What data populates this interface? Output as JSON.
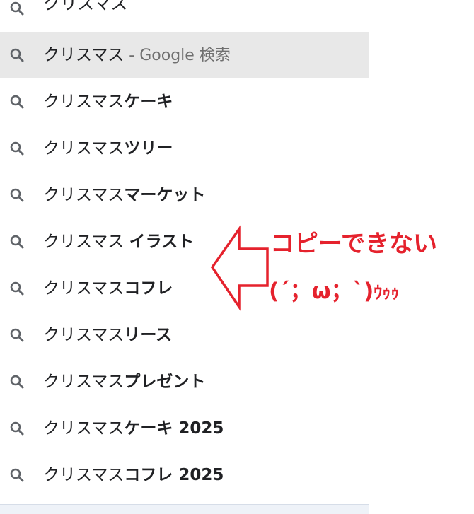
{
  "omnibox": {
    "input_text": "クリスマス"
  },
  "suggestions": [
    {
      "prefix": "クリスマス",
      "bold": "",
      "suffix": " - Google 検索",
      "selected": true
    },
    {
      "prefix": "クリスマス",
      "bold": "ケーキ",
      "suffix": "",
      "selected": false
    },
    {
      "prefix": "クリスマス",
      "bold": "ツリー",
      "suffix": "",
      "selected": false
    },
    {
      "prefix": "クリスマス",
      "bold": "マーケット",
      "suffix": "",
      "selected": false
    },
    {
      "prefix": "クリスマス ",
      "bold": "イラスト",
      "suffix": "",
      "selected": false
    },
    {
      "prefix": "クリスマス",
      "bold": "コフレ",
      "suffix": "",
      "selected": false
    },
    {
      "prefix": "クリスマス",
      "bold": "リース",
      "suffix": "",
      "selected": false
    },
    {
      "prefix": "クリスマス",
      "bold": "プレゼント",
      "suffix": "",
      "selected": false
    },
    {
      "prefix": "クリスマス",
      "bold": "ケーキ 2025",
      "suffix": "",
      "selected": false
    },
    {
      "prefix": "クリスマス",
      "bold": "コフレ 2025",
      "suffix": "",
      "selected": false
    }
  ],
  "annotation": {
    "line1": "コピーできない",
    "line2_main": "(´；ω；`)",
    "line2_tail": "ｳｩｩ",
    "color": "#e5222d"
  },
  "icons": {
    "suggestion_icon": "search-icon"
  }
}
